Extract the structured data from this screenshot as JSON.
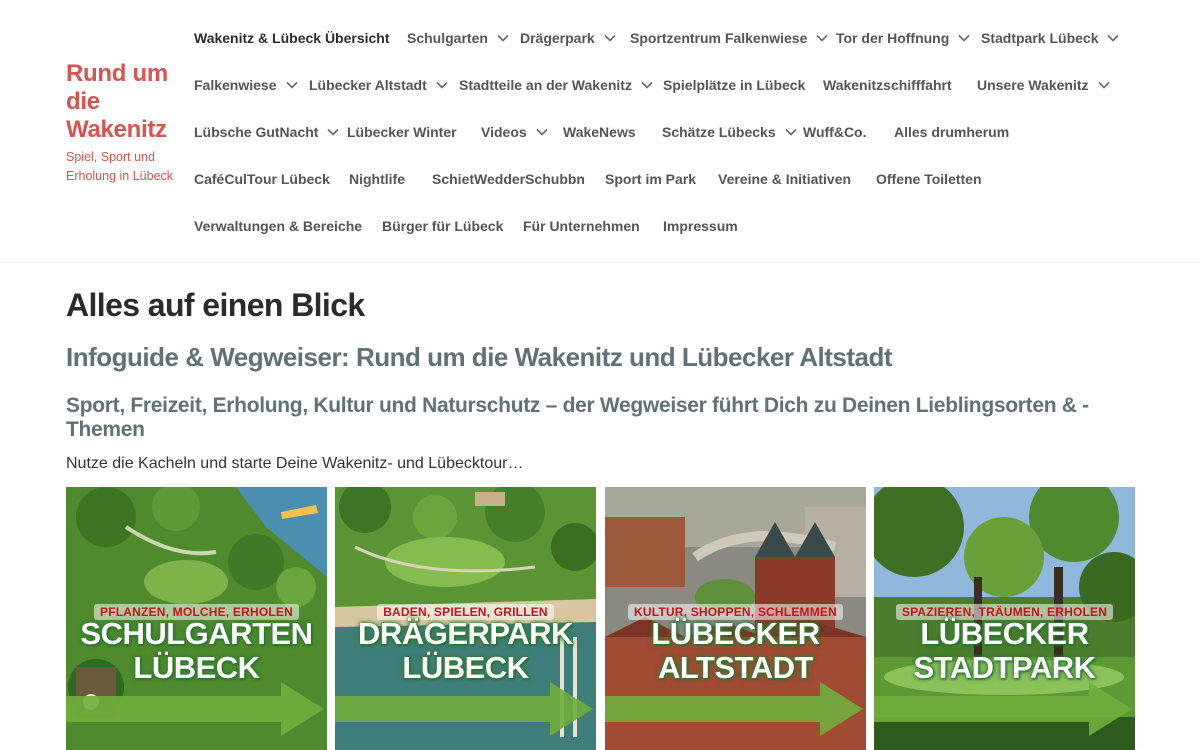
{
  "site": {
    "title": "Rund um die Wakenitz",
    "tagline": "Spiel, Sport und Erholung in Lübeck"
  },
  "nav": {
    "rows": [
      [
        {
          "label": "Wakenitz & Lübeck Übersicht",
          "dropdown": false
        },
        {
          "label": "Schulgarten",
          "dropdown": true
        },
        {
          "label": "Drägerpark",
          "dropdown": true
        },
        {
          "label": "Sportzentrum Falkenwiese",
          "dropdown": true
        },
        {
          "label": "Tor der Hoffnung",
          "dropdown": true
        },
        {
          "label": "Stadtpark Lübeck",
          "dropdown": true
        }
      ],
      [
        {
          "label": "Falkenwiese",
          "dropdown": true
        },
        {
          "label": "Lübecker Altstadt",
          "dropdown": true
        },
        {
          "label": "Stadtteile an der Wakenitz",
          "dropdown": true
        },
        {
          "label": "Spielplätze in Lübeck",
          "dropdown": false
        },
        {
          "label": "Wakenitzschifffahrt",
          "dropdown": false
        },
        {
          "label": "Unsere Wakenitz",
          "dropdown": true
        }
      ],
      [
        {
          "label": "Lübsche GutNacht",
          "dropdown": true
        },
        {
          "label": "Lübecker Winter",
          "dropdown": false
        },
        {
          "label": "Videos",
          "dropdown": true
        },
        {
          "label": "WakeNews",
          "dropdown": false
        },
        {
          "label": "Schätze Lübecks",
          "dropdown": true
        },
        {
          "label": "Wuff&Co.",
          "dropdown": false
        },
        {
          "label": "Alles drumherum",
          "dropdown": false
        }
      ],
      [
        {
          "label": "CaféCulTour Lübeck",
          "dropdown": false
        },
        {
          "label": "Nightlife",
          "dropdown": false
        },
        {
          "label": "SchietWedderSchubbn",
          "dropdown": false
        },
        {
          "label": "Sport im Park",
          "dropdown": false
        },
        {
          "label": "Vereine & Initiativen",
          "dropdown": false
        },
        {
          "label": "Offene Toiletten",
          "dropdown": false
        }
      ],
      [
        {
          "label": "Verwaltungen & Bereiche",
          "dropdown": false
        },
        {
          "label": "Bürger für Lübeck",
          "dropdown": false
        },
        {
          "label": "Für Unternehmen",
          "dropdown": false
        },
        {
          "label": "Impressum",
          "dropdown": false
        }
      ]
    ]
  },
  "main": {
    "page_title": "Alles auf einen Blick",
    "heading": "Infoguide & Wegweiser: Rund um die Wakenitz und Lübecker Altstadt",
    "subheading": "Sport, Freizeit, Erholung, Kultur und Naturschutz – der Wegweiser führt Dich zu Deinen Lieblingsorten & -Themen",
    "intro": "Nutze die Kacheln und starte Deine Wakenitz- und Lübecktour…"
  },
  "tiles": [
    {
      "kicker": "PFLANZEN, MOLCHE, ERHOLEN",
      "line1": "SCHULGARTEN",
      "line2": "LÜBECK",
      "scene": "garden"
    },
    {
      "kicker": "BADEN, SPIELEN, GRILLEN",
      "line1": "DRÄGERPARK",
      "line2": "LÜBECK",
      "scene": "park"
    },
    {
      "kicker": "KULTUR, SHOPPEN, SCHLEMMEN",
      "line1": "LÜBECKER",
      "line2": "ALTSTADT",
      "scene": "city"
    },
    {
      "kicker": "SPAZIEREN, TRÄUMEN, ERHOLEN",
      "line1": "LÜBECKER",
      "line2": "STADTPARK",
      "scene": "forest"
    }
  ],
  "colors": {
    "brand": "#d9534f",
    "heading": "#617178",
    "arrow": "#6fae3c",
    "kicker": "#c4161c"
  }
}
